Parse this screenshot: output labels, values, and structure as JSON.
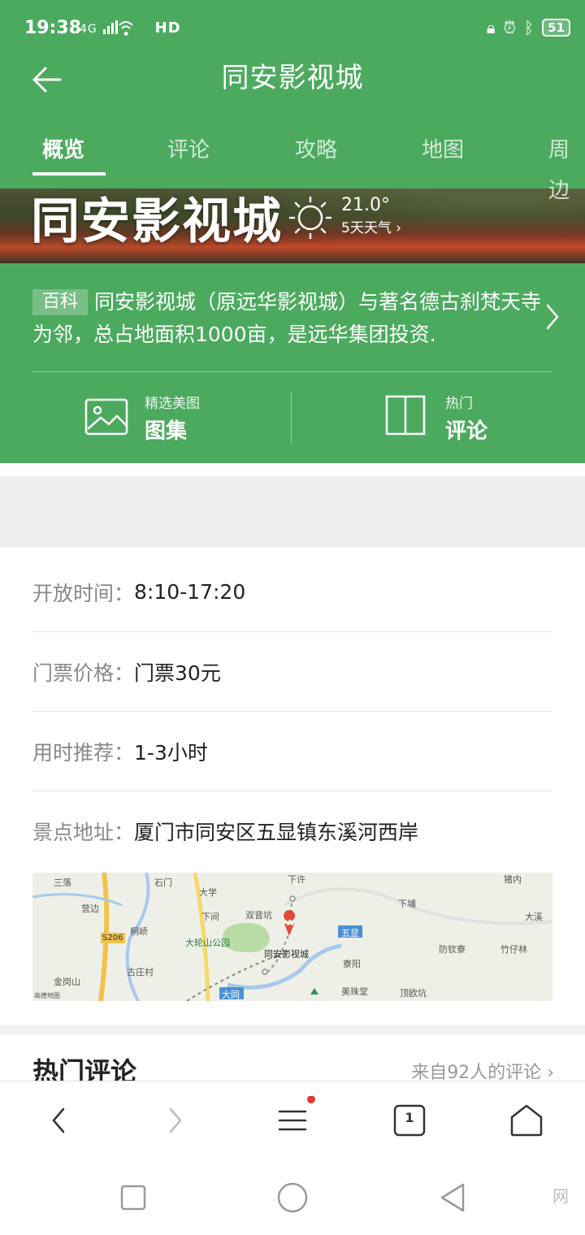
{
  "status_bar": {
    "time": "19:38",
    "signal_text": "4G",
    "hd_text": "HD",
    "battery": "51",
    "icons": [
      "lock-icon",
      "alarm-icon",
      "bluetooth-icon"
    ]
  },
  "header": {
    "title": "同安影视城",
    "tabs": [
      {
        "label": "概览",
        "active": true
      },
      {
        "label": "评论",
        "active": false
      },
      {
        "label": "攻略",
        "active": false
      },
      {
        "label": "地图",
        "active": false
      },
      {
        "label": "周边",
        "active": false
      }
    ]
  },
  "hero": {
    "name": "同安影视城",
    "temperature": "21.0°",
    "forecast_link": "5天天气"
  },
  "baike": {
    "tag": "百科",
    "text": "同安影视城（原远华影视城）与著名德古刹梵天寺为邻，总占地面积1000亩，是远华集团投资."
  },
  "quick_links": {
    "gallery": {
      "sub": "精选美图",
      "main": "图集"
    },
    "reviews": {
      "sub": "热门",
      "main": "评论"
    }
  },
  "details": [
    {
      "key": "开放时间：",
      "value": "8:10-17:20"
    },
    {
      "key": "门票价格：",
      "value": "门票30元"
    },
    {
      "key": "用时推荐：",
      "value": "1-3小时"
    },
    {
      "key": "景点地址：",
      "value": "厦门市同安区五显镇东溪河西岸"
    }
  ],
  "map": {
    "labels": {
      "sanluo": "三落",
      "shimen": "石门",
      "daxue": "大学",
      "xiaxu": "下许",
      "zhunei": "猪内",
      "yingbian": "营边",
      "xiajian": "下间",
      "shuangyinkeng": "双音坑",
      "xiapu": "下埔",
      "daxi": "大溪",
      "tongqiao": "桐峤",
      "s206": "S206",
      "dalunshan": "大轮山公园",
      "poi": "同安影视城",
      "wuxian": "五显",
      "fanqin": "防钦寮",
      "zhuzailin": "竹仔林",
      "guzhuang": "古庄村",
      "jinyang": "寮阳",
      "jingangshan": "金岗山",
      "datong": "大同",
      "meizhutang": "美珠堂",
      "dingqin": "顶欧坑",
      "provider": "高德地图",
      "marker": "A"
    }
  },
  "hot_reviews": {
    "title": "热门评论",
    "more": "来自92人的评论"
  },
  "browser_bar": {
    "tab_count": "1"
  },
  "watermark": "网"
}
